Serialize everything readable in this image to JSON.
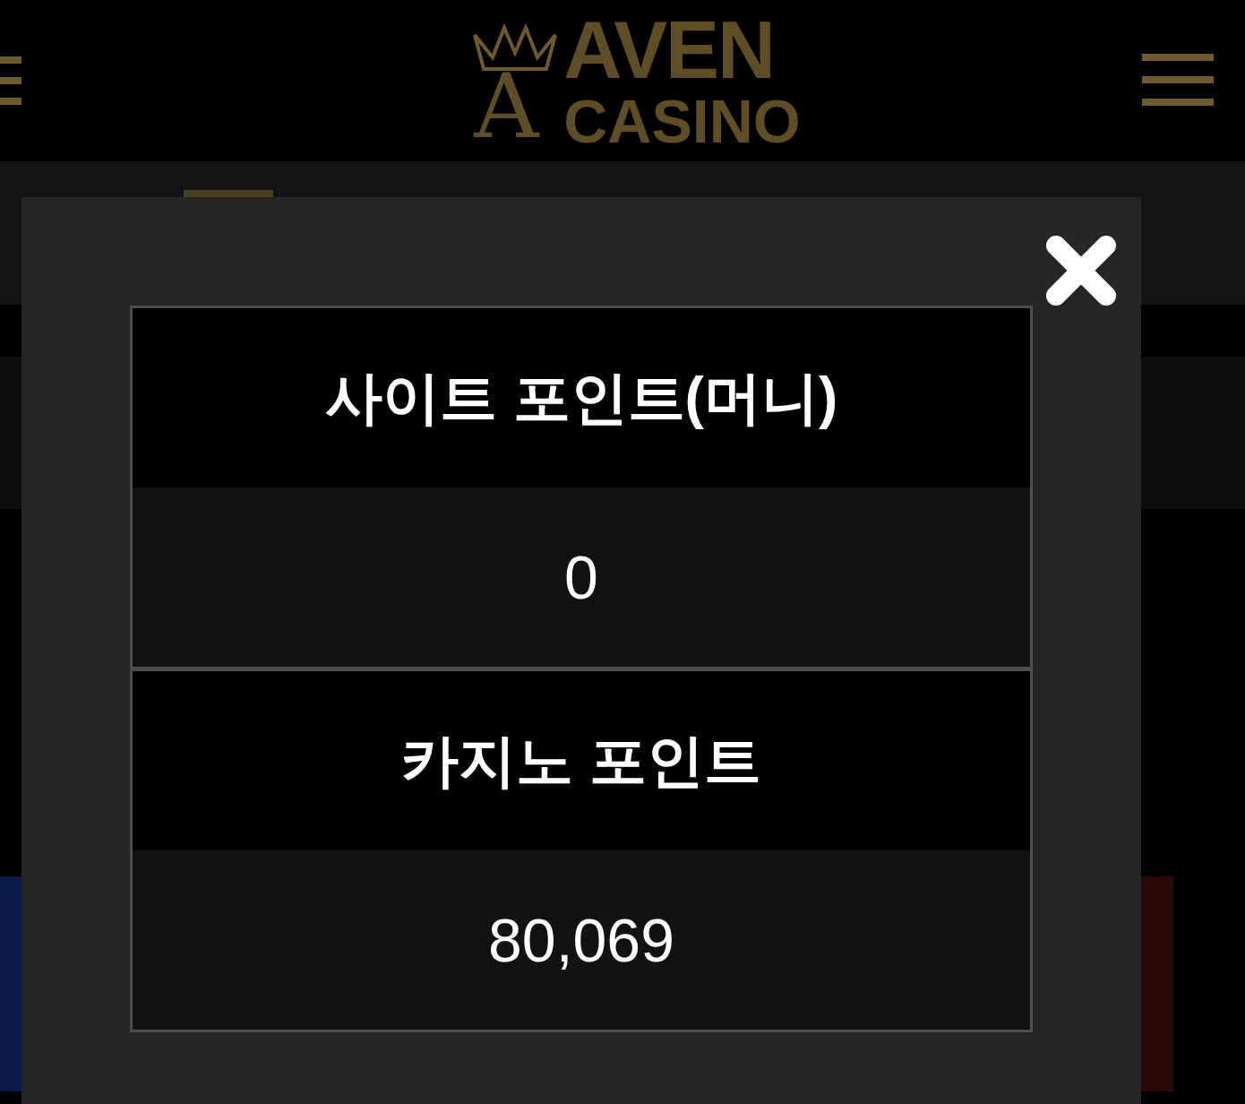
{
  "header": {
    "logo": {
      "monogram": "A",
      "top": "AVEN",
      "bottom": "CASINO"
    }
  },
  "modal": {
    "rows": [
      {
        "label": "사이트 포인트(머니)",
        "value": "0"
      },
      {
        "label": "카지노 포인트",
        "value": "80,069"
      }
    ]
  }
}
